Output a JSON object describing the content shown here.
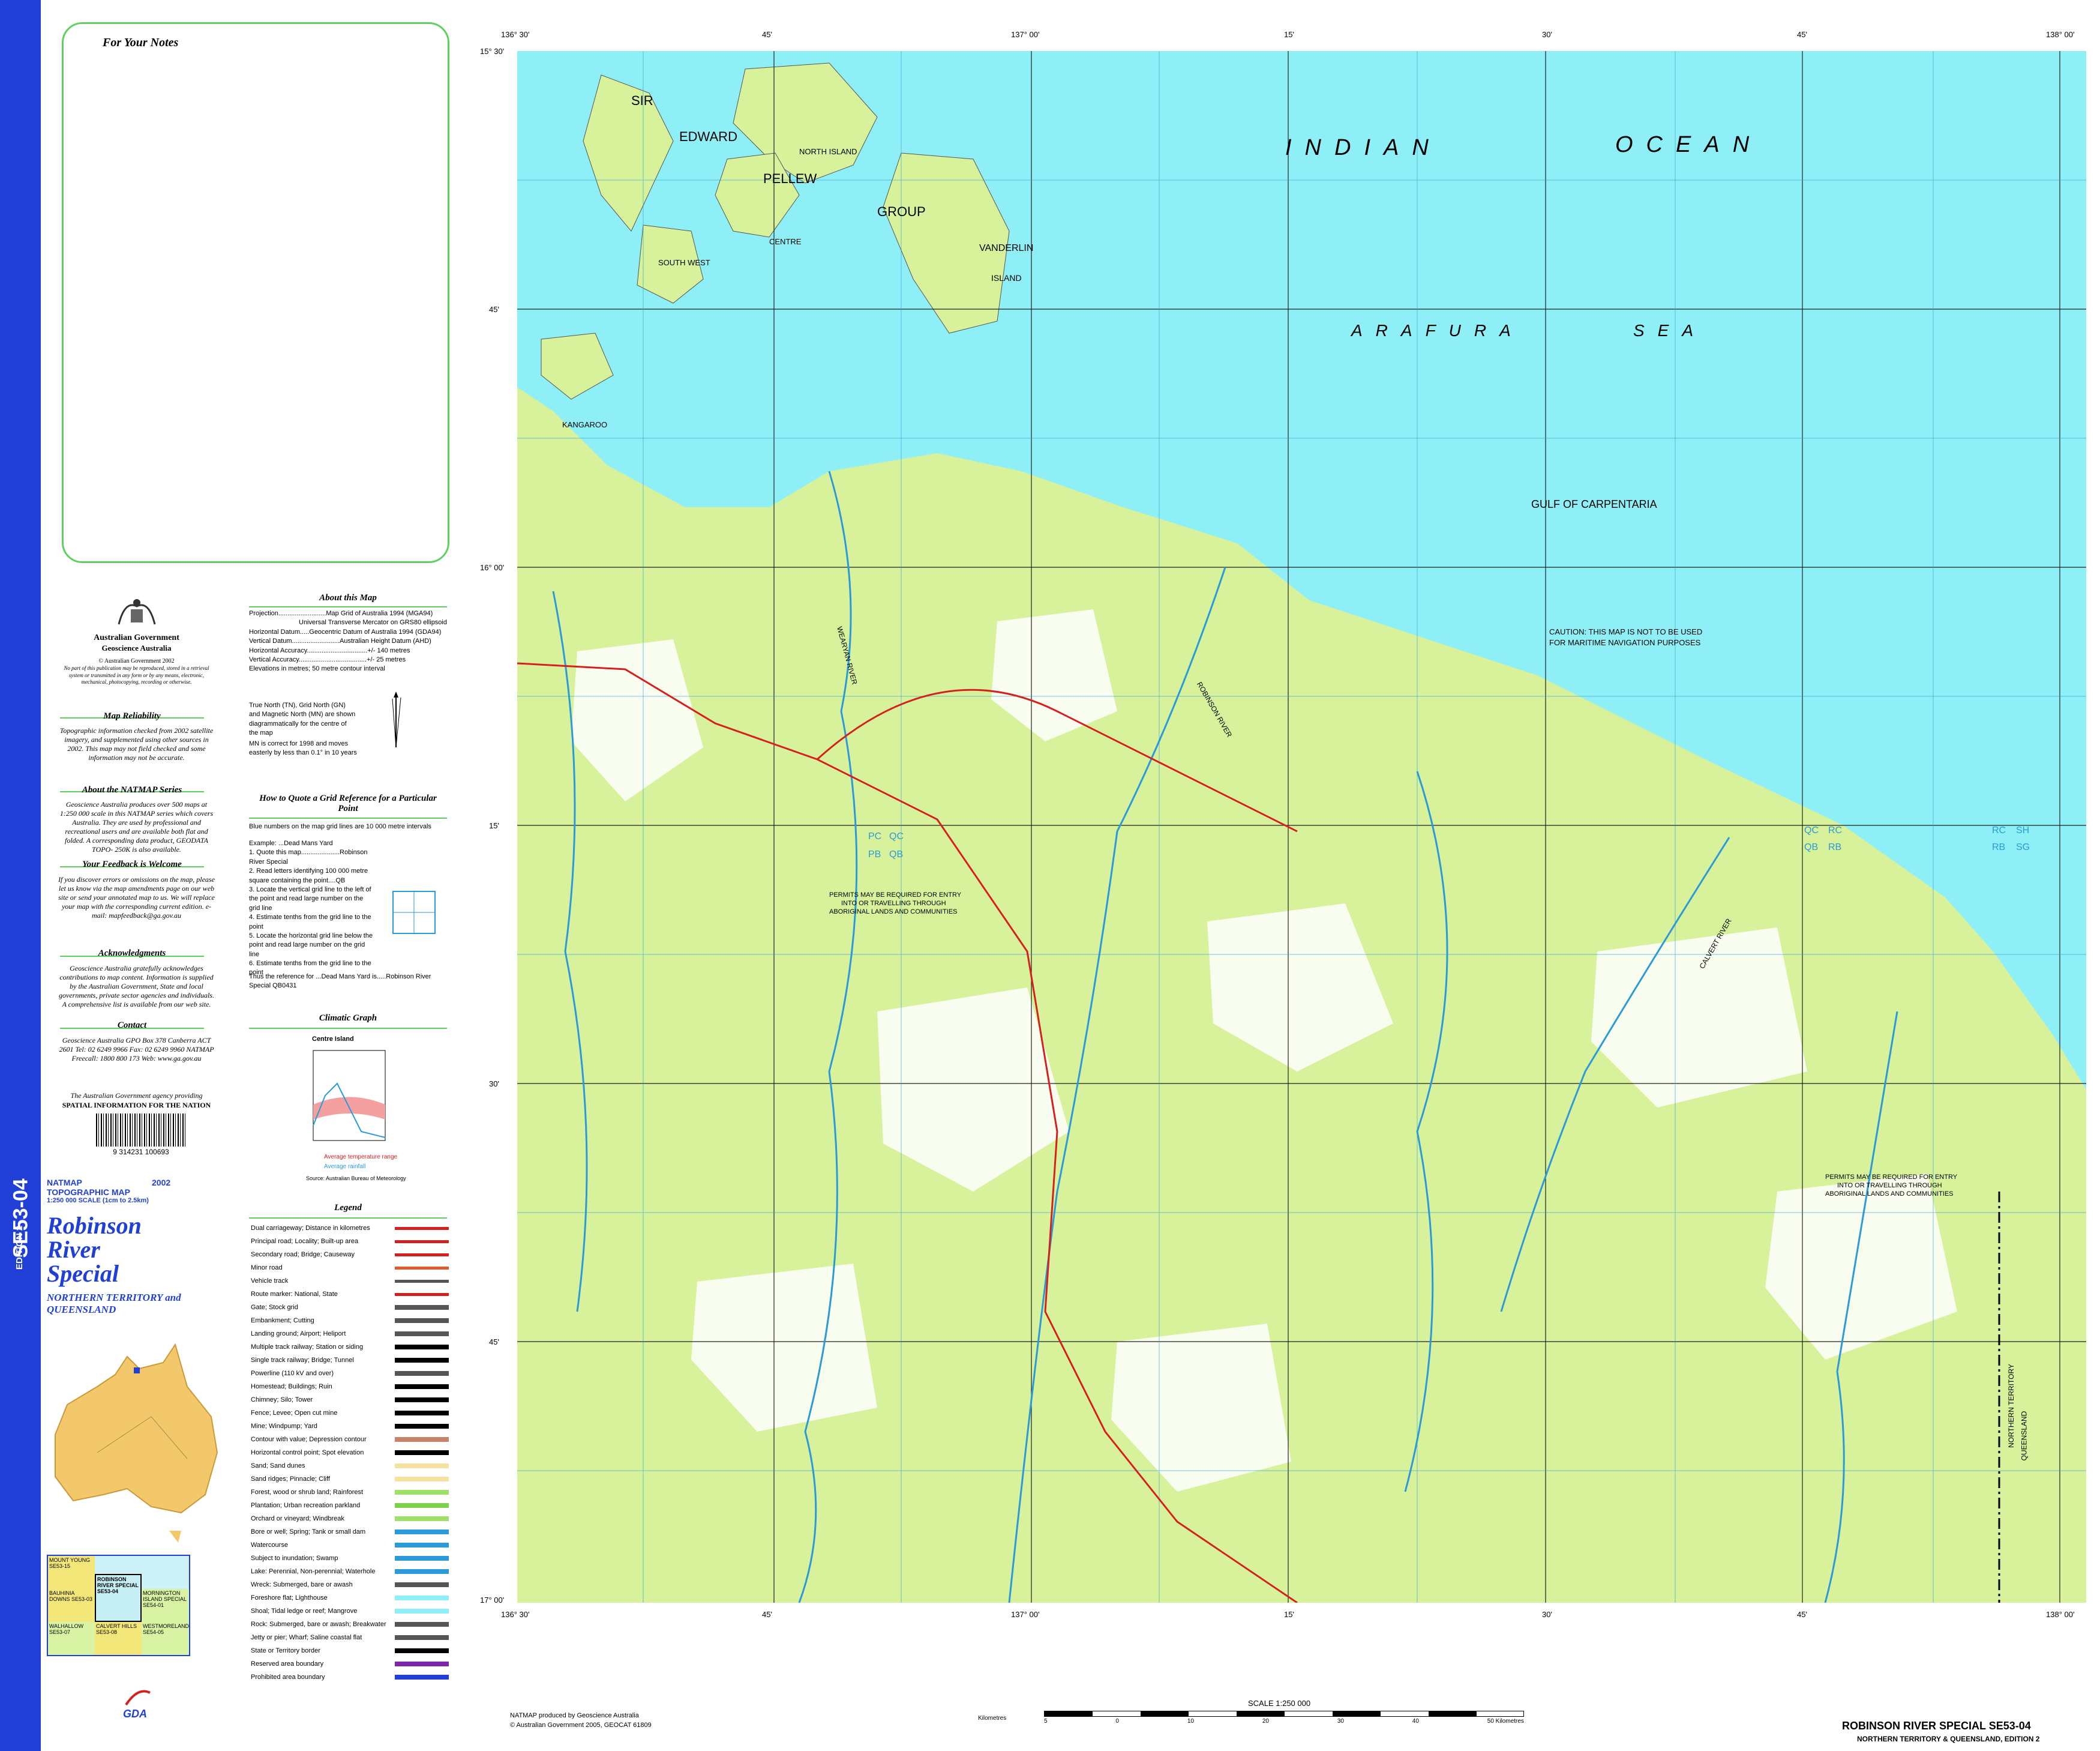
{
  "spine": {
    "code": "SE53-04",
    "edition": "EDITION 2"
  },
  "notes": {
    "title": "For Your Notes"
  },
  "gov": {
    "agency": "Australian Government",
    "sub": "Geoscience Australia",
    "copyright": "© Australian Government 2002",
    "copy_note": "No part of this publication may be reproduced, stored in a retrieval system or transmitted in any form or by any means, electronic, mechanical, photocopying, recording or otherwise."
  },
  "sections": {
    "reliability_title": "Map Reliability",
    "reliability_text": "Topographic information checked from 2002 satellite imagery, and supplemented using other sources in 2002. This map may not field checked and some information may not be accurate.",
    "natmap_title": "About the NATMAP Series",
    "natmap_text": "Geoscience Australia produces over 500 maps at 1:250 000 scale in this NATMAP series which covers Australia. They are used by professional and recreational users and are available both flat and folded. A corresponding data product, GEODATA TOPO- 250K is also available.",
    "feedback_title": "Your Feedback is Welcome",
    "feedback_text": "If you discover errors or omissions on the map, please let us know via the map amendments page on our web site or send your annotated map to us. We will replace your map with the corresponding current edition. e- mail: mapfeedback@ga.gov.au",
    "ack_title": "Acknowledgments",
    "ack_text": "Geoscience Australia gratefully acknowledges contributions to map content. Information is supplied by the Australian Government, State and local governments, private sector agencies and individuals. A comprehensive list is available from our web site.",
    "contact_title": "Contact",
    "contact_text": "Geoscience Australia GPO Box 378 Canberra ACT 2601 Tel: 02 6249 9966 Fax: 02 6249 9960 NATMAP Freecall: 1800 800 173 Web: www.ga.gov.au",
    "agency_note": "The Australian Government agency providing",
    "agency_bold": "SPATIAL INFORMATION FOR THE NATION",
    "barcode": "9 314231 100693"
  },
  "title_block": {
    "series": "NATMAP",
    "year": "2002",
    "type": "TOPOGRAPHIC MAP",
    "scale": "1:250 000 SCALE (1cm to 2.5km)",
    "name1": "Robinson",
    "name2": "River",
    "name3": "Special",
    "region": "NORTHERN TERRITORY and QUEENSLAND"
  },
  "about": {
    "title": "About this Map",
    "lines": [
      "Projection..........................Map Grid of Australia 1994 (MGA94)",
      "Universal Transverse Mercator on GRS80 ellipsoid",
      "Horizontal Datum.....Geocentric Datum of Australia 1994 (GDA94)",
      "Vertical Datum..........................Australian Height Datum (AHD)",
      "Horizontal Accuracy.................................+/- 140 metres",
      "Vertical Accuracy.....................................+/- 25 metres",
      "Elevations in metres; 50 metre contour interval"
    ],
    "north": "True North (TN), Grid North (GN) and Magnetic North (MN) are shown diagrammatically for the centre of the map",
    "mn": "MN is correct for 1998 and moves easterly by less than 0.1° in 10 years"
  },
  "gridref": {
    "title": "How to Quote a Grid Reference for a Particular Point",
    "intro": "Blue numbers on the map grid lines are 10 000 metre intervals",
    "example": "Example: ...Dead Mans Yard",
    "steps": [
      "1. Quote this map.....................Robinson River Special",
      "2. Read letters identifying 100 000 metre square containing the point....QB",
      "3. Locate the vertical grid line to the left of the point and read large number on the grid line",
      "4. Estimate tenths from the grid line to the point",
      "5. Locate the horizontal grid line below the point and read large number on the grid line",
      "6. Estimate tenths from the grid line to the point"
    ],
    "result": "Thus the reference for ...Dead Mans Yard is.....Robinson River Special QB0431"
  },
  "climate": {
    "title": "Climatic Graph",
    "station": "Centre Island",
    "legend1": "Average temperature range",
    "legend2": "Average rainfall",
    "source": "Source: Australian Bureau of Meteorology"
  },
  "legend": {
    "title": "Legend",
    "items": [
      "Dual carriageway; Distance in kilometres",
      "Principal road; Locality; Built-up area",
      "Secondary road; Bridge; Causeway",
      "Minor road",
      "Vehicle track",
      "Route marker: National, State",
      "Gate; Stock grid",
      "Embankment; Cutting",
      "Landing ground; Airport; Heliport",
      "Multiple track railway; Station or siding",
      "Single track railway; Bridge; Tunnel",
      "Powerline (110 kV and over)",
      "Homestead; Buildings; Ruin",
      "Chimney; Silo; Tower",
      "Fence; Levee; Open cut mine",
      "Mine; Windpump; Yard",
      "Contour with value; Depression contour",
      "Horizontal control point; Spot elevation",
      "Sand; Sand dunes",
      "Sand ridges; Pinnacle; Cliff",
      "Forest, wood or shrub land; Rainforest",
      "Plantation; Urban recreation parkland",
      "Orchard or vineyard; Windbreak",
      "Bore or well; Spring; Tank or small dam",
      "Watercourse",
      "Subject to inundation; Swamp",
      "Lake: Perennial, Non-perennial; Waterhole",
      "Wreck: Submerged, bare or awash",
      "Foreshore flat; Lighthouse",
      "Shoal; Tidal ledge or reef; Mangrove",
      "Rock: Submerged, bare or awash; Breakwater",
      "Jetty or pier; Wharf; Saline coastal flat",
      "State or Territory border",
      "Reserved area boundary",
      "Prohibited area boundary"
    ]
  },
  "index_maps": [
    "MOUNT YOUNG SE53-15",
    "BAUHINIA DOWNS SE53-03",
    "ROBINSON RIVER SPECIAL SE53-04",
    "MORNINGTON ISLAND SPECIAL SE54-01",
    "WALHALLOW SE53-07",
    "CALVERT HILLS SE53-08",
    "WESTMORELAND SE54-05"
  ],
  "gda": "GDA",
  "map_labels": {
    "ocean1": "INDIAN",
    "ocean2": "OCEAN",
    "sea1": "ARAFURA",
    "sea2": "SEA",
    "gulf": "GULF OF CARPENTARIA",
    "sir": "SIR",
    "edward": "EDWARD",
    "pellew": "PELLEW",
    "group": "GROUP",
    "vanderlin": "VANDERLIN",
    "island": "ISLAND",
    "north_island": "NORTH ISLAND",
    "centre": "CENTRE",
    "south_west": "SOUTH WEST",
    "kangaroo": "KANGAROO",
    "caution1": "CAUTION: THIS MAP IS NOT TO BE USED",
    "caution2": "FOR MARITIME NAVIGATION PURPOSES",
    "permit1": "PERMITS MAY BE REQUIRED FOR ENTRY",
    "permit2": "INTO OR TRAVELLING THROUGH",
    "permit3": "ABORIGINAL LANDS AND COMMUNITIES",
    "robinson_river": "ROBINSON RIVER",
    "calvert": "CALVERT RIVER",
    "wearyan": "WEARYAN RIVER",
    "nt": "NORTHERN TERRITORY",
    "qld": "QUEENSLAND",
    "grid_qc": "QC",
    "grid_rc": "RC",
    "grid_qb": "QB",
    "grid_rb": "RB",
    "grid_sh": "SH",
    "grid_sg": "SG",
    "grid_pc": "PC",
    "grid_pb": "PB"
  },
  "map_ticks": {
    "lon": [
      "136° 30'",
      "45'",
      "137° 00'",
      "15'",
      "30'",
      "45'",
      "138° 00'"
    ],
    "lat": [
      "15° 30'",
      "45'",
      "16° 00'",
      "15'",
      "30'",
      "45'",
      "17° 00'"
    ]
  },
  "footer": {
    "credit1": "NATMAP produced by Geoscience Australia",
    "credit2": "© Australian Government 2005, GEOCAT 61809",
    "scale": "SCALE 1:250 000",
    "km": "Kilometres",
    "title": "ROBINSON RIVER SPECIAL SE53-04",
    "sub": "NORTHERN TERRITORY & QUEENSLAND, EDITION 2",
    "scale_ticks": [
      "5",
      "0",
      "10",
      "20",
      "30",
      "40",
      "50 Kilometres"
    ]
  },
  "colors": {
    "sea": "#8ef0f6",
    "land": "#d7f29b",
    "bare": "#ffffff",
    "spine": "#1f3fd6",
    "frame": "#5fcf5f",
    "road": "#d62020",
    "river": "#2a9ad8",
    "contour": "#c8826a"
  }
}
